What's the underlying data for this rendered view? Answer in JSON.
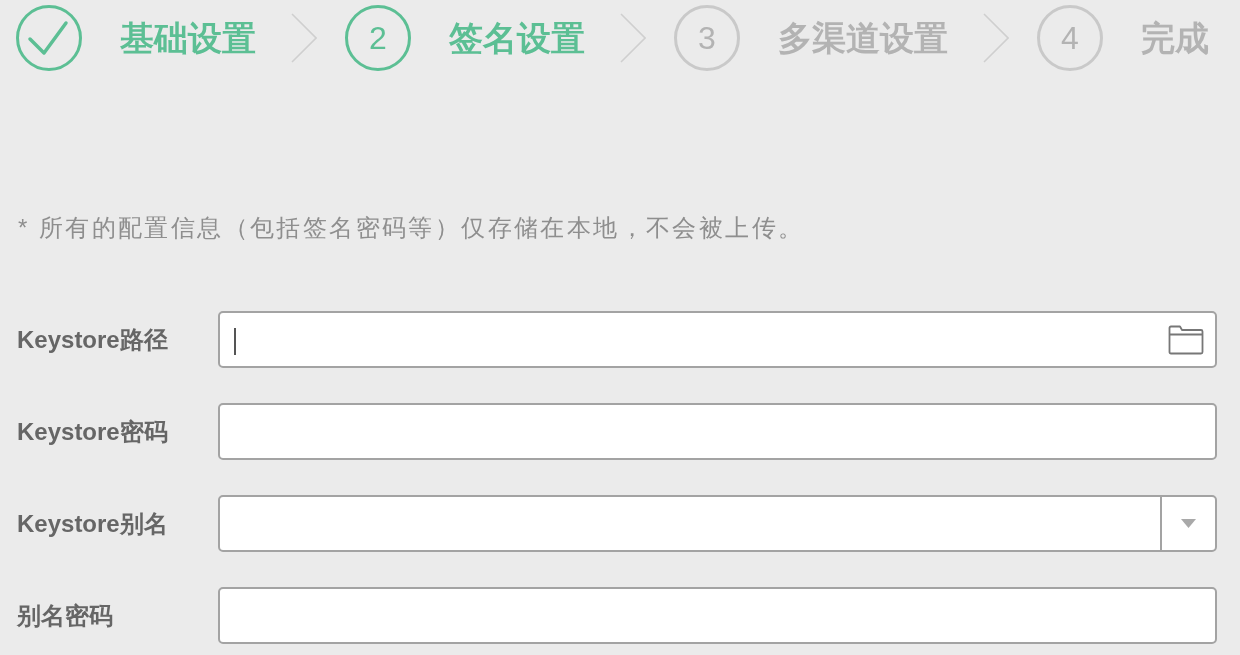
{
  "steps": [
    {
      "completed": true,
      "selected": false,
      "label": "基础设置"
    },
    {
      "completed": false,
      "selected": true,
      "number": "2",
      "label": "签名设置"
    },
    {
      "completed": false,
      "selected": false,
      "number": "3",
      "label": "多渠道设置"
    },
    {
      "completed": false,
      "selected": false,
      "number": "4",
      "label": "完成"
    }
  ],
  "note": "* 所有的配置信息（包括签名密码等）仅存储在本地，不会被上传。",
  "fields": [
    {
      "kind": "file",
      "label": "Keystore路径",
      "focused": true
    },
    {
      "kind": "text",
      "label": "Keystore密码",
      "focused": false
    },
    {
      "kind": "select",
      "label": "Keystore别名",
      "focused": false
    },
    {
      "kind": "text",
      "label": "别名密码",
      "focused": false
    }
  ]
}
